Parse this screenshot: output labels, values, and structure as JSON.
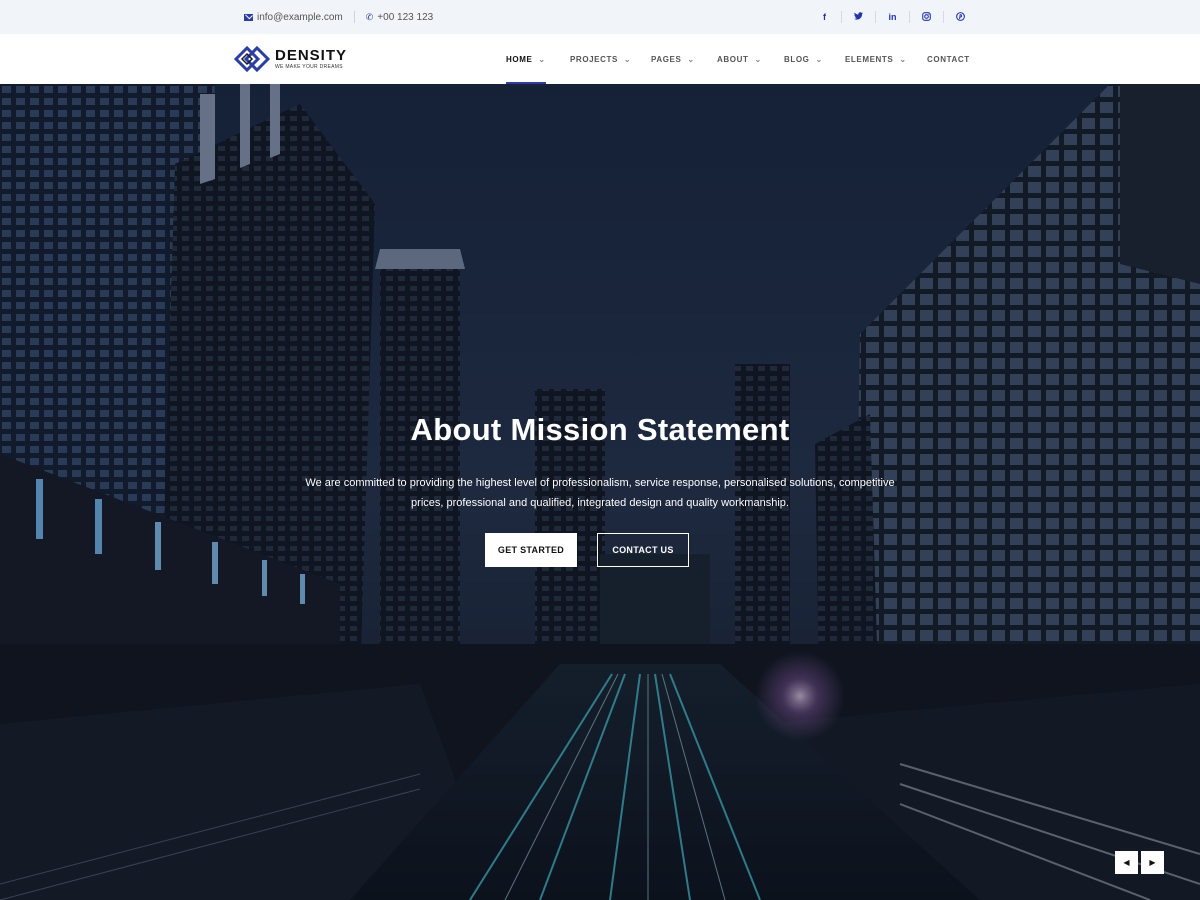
{
  "topbar": {
    "email": "info@example.com",
    "phone": "+00 123 123",
    "social": [
      {
        "icon": "facebook-icon",
        "glyph": "f"
      },
      {
        "icon": "twitter-icon",
        "glyph": "t"
      },
      {
        "icon": "linkedin-icon",
        "glyph": "in"
      },
      {
        "icon": "instagram-icon",
        "glyph": "◎"
      },
      {
        "icon": "pinterest-icon",
        "glyph": "℗"
      }
    ]
  },
  "brand": {
    "name": "DENSITY",
    "tagline": "WE MAKE YOUR DREAMS",
    "accent_color": "#2b3ea8"
  },
  "nav": {
    "items": [
      {
        "label": "HOME",
        "has_dropdown": true,
        "active": true
      },
      {
        "label": "PROJECTS",
        "has_dropdown": true,
        "active": false
      },
      {
        "label": "PAGES",
        "has_dropdown": true,
        "active": false
      },
      {
        "label": "ABOUT",
        "has_dropdown": true,
        "active": false
      },
      {
        "label": "BLOG",
        "has_dropdown": true,
        "active": false
      },
      {
        "label": "ELEMENTS",
        "has_dropdown": true,
        "active": false
      },
      {
        "label": "CONTACT",
        "has_dropdown": false,
        "active": false
      }
    ]
  },
  "hero": {
    "title": "About Mission Statement",
    "text_line1": "We are committed to providing the highest level of professionalism, service response, personalised solutions, competitive",
    "text_line2": "prices, professional and qualified, integrated design and quality workmanship.",
    "primary_button": "GET STARTED",
    "secondary_button": "CONTACT US",
    "prev_icon": "chevron-left-icon",
    "next_icon": "chevron-right-icon"
  }
}
